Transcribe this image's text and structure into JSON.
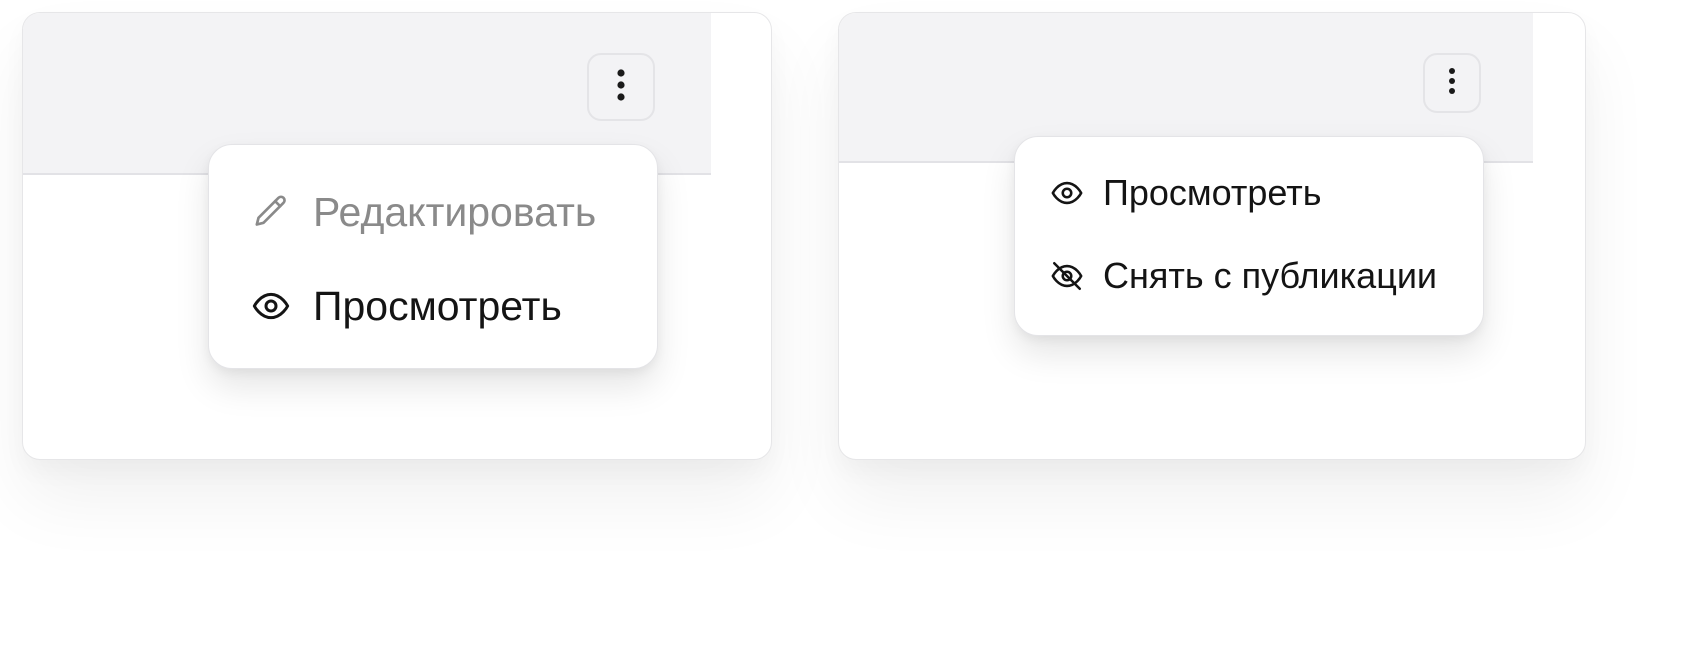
{
  "colors": {
    "header_bg": "#f3f3f5",
    "text_primary": "#141414",
    "text_disabled": "#8a8a8a",
    "border": "#e4e4e7"
  },
  "cards": [
    {
      "more_button_icon": "more-vertical-icon",
      "menu": {
        "items": [
          {
            "icon": "pencil-icon",
            "label": "Редактировать",
            "disabled": true
          },
          {
            "icon": "eye-icon",
            "label": "Просмотреть",
            "disabled": false
          }
        ]
      }
    },
    {
      "more_button_icon": "more-vertical-icon",
      "menu": {
        "items": [
          {
            "icon": "eye-icon",
            "label": "Просмотреть",
            "disabled": false
          },
          {
            "icon": "eye-off-icon",
            "label": "Снять с публикации",
            "disabled": false
          }
        ]
      }
    }
  ]
}
